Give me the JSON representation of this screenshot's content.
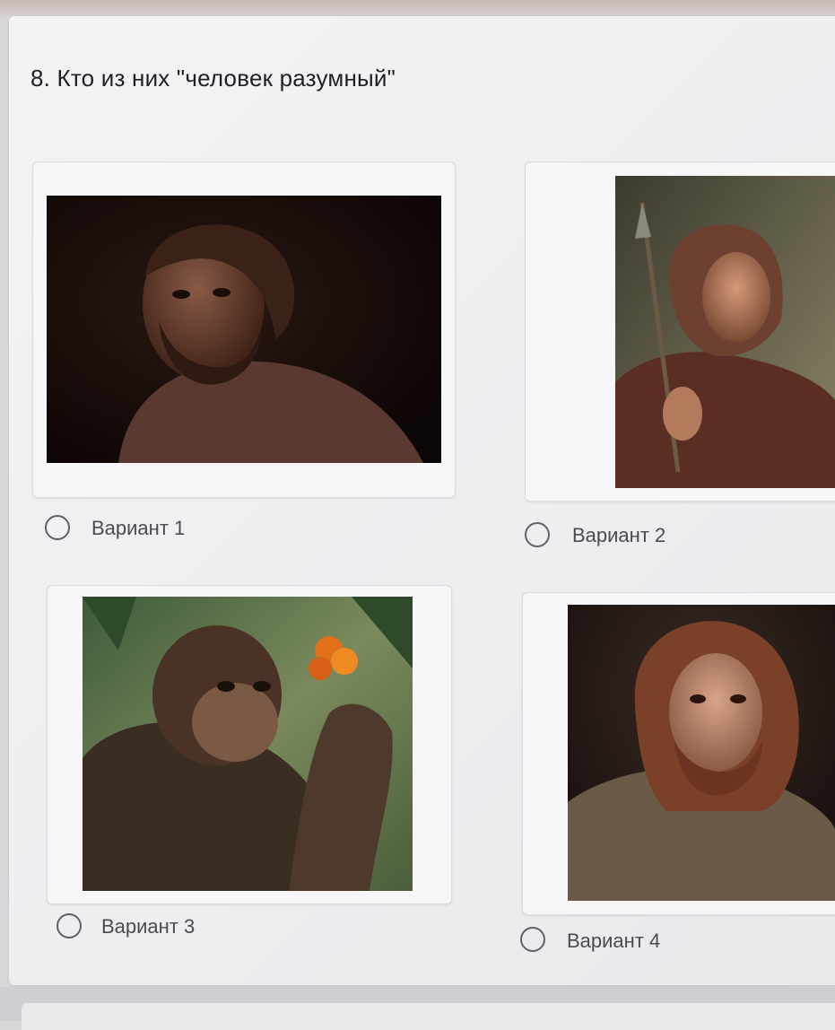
{
  "question": {
    "text": "8. Кто из них \"человек разумный\""
  },
  "options": [
    {
      "label": "Вариант 1",
      "image_icon": "portrait-icon"
    },
    {
      "label": "Вариант 2",
      "image_icon": "portrait-icon"
    },
    {
      "label": "Вариант 3",
      "image_icon": "portrait-icon"
    },
    {
      "label": "Вариант 4",
      "image_icon": "portrait-icon"
    }
  ],
  "colors": {
    "background": "#eeeef1",
    "text": "#1f1f24",
    "option_label": "#4a4b52",
    "radio_border": "#5f6068"
  }
}
